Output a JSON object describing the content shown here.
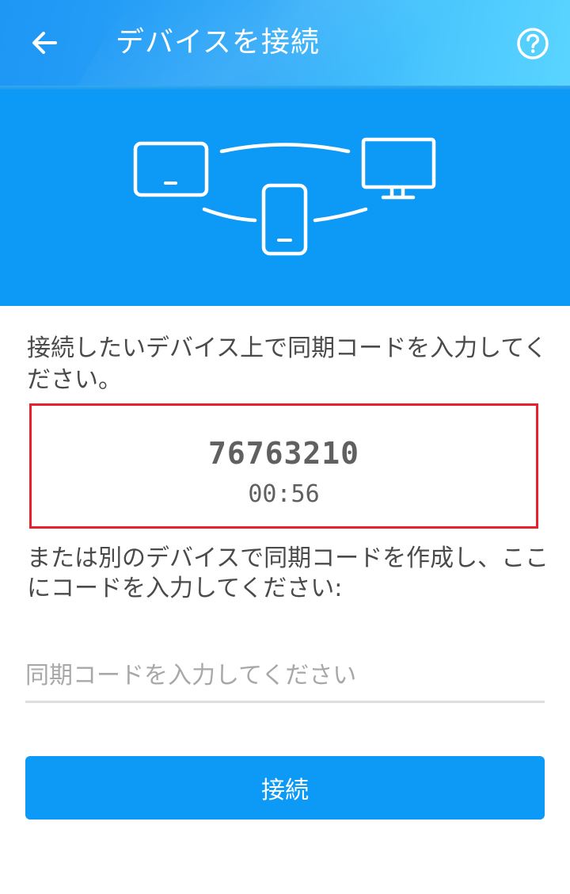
{
  "header": {
    "title": "デバイスを接続",
    "back_icon": "arrow-left-icon",
    "help_icon": "question-circle-icon"
  },
  "hero": {
    "icons": [
      "tablet-icon",
      "phone-icon",
      "monitor-icon"
    ]
  },
  "instruction": "接続したいデバイス上で同期コードを入力してください。",
  "sync": {
    "code": "76763210",
    "countdown": "00:56"
  },
  "alt_instruction": "または別のデバイスで同期コードを作成し、ここにコードを入力してください:",
  "input": {
    "value": "",
    "placeholder": "同期コードを入力してください"
  },
  "connect_button": {
    "label": "接続"
  },
  "colors": {
    "primary": "#0d9af7",
    "highlight_border": "#e8202b",
    "text": "#4a4a4a"
  }
}
